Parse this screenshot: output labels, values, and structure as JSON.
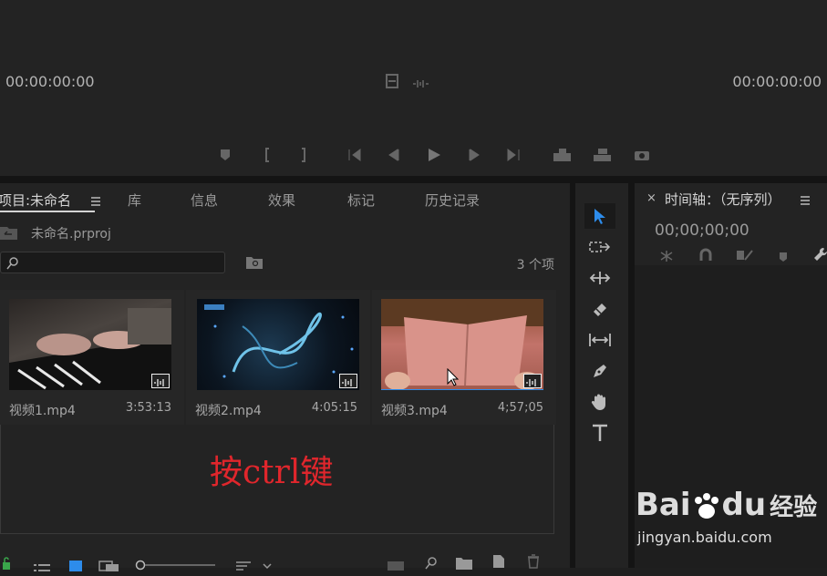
{
  "monitor": {
    "timecode_left": "00:00:00:00",
    "timecode_right": "00:00:00:00"
  },
  "project": {
    "tabs": [
      "项目:未命名",
      "库",
      "信息",
      "效果",
      "标记",
      "历史记录"
    ],
    "menu_icon": "hamburger-icon",
    "file_name": "未命名.prproj",
    "search_placeholder": "",
    "item_count": "3 个项",
    "clips": [
      {
        "name": "视频1.mp4",
        "duration": "3:53:13"
      },
      {
        "name": "视频2.mp4",
        "duration": "4:05:15"
      },
      {
        "name": "视频3.mp4",
        "duration": "4;57;05"
      }
    ],
    "annotation": "按ctrl键"
  },
  "timeline": {
    "title": "时间轴：（无序列）",
    "timecode": "00;00;00;00"
  },
  "watermark": {
    "brand": "Bai",
    "brand2": "du",
    "brand3": "经验",
    "url": "jingyan.baidu.com"
  },
  "colors": {
    "accent": "#2d8ceb",
    "annotation": "#e0262c",
    "panel": "#232323"
  }
}
